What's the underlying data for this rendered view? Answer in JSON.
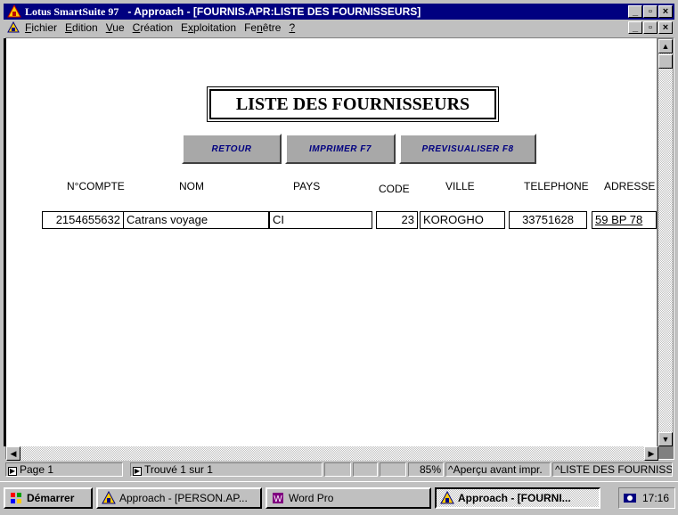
{
  "window": {
    "app_name": "Lotus SmartSuite 97",
    "title": "-  Approach - [FOURNIS.APR:LISTE DES FOURNISSEURS]",
    "controls": [
      "_",
      "🗗",
      "✕"
    ]
  },
  "menu": {
    "items": [
      {
        "label": "Fichier",
        "key": "F",
        "rest": "ichier"
      },
      {
        "label": "Edition",
        "key": "E",
        "rest": "dition"
      },
      {
        "label": "Vue",
        "key": "V",
        "rest": "ue"
      },
      {
        "label": "Création",
        "key": "C",
        "rest": "réation"
      },
      {
        "label": "Exploitation",
        "pre": "E",
        "key": "x",
        "rest": "ploitation"
      },
      {
        "label": "Fenêtre",
        "pre": "Fe",
        "key": "n",
        "rest": "être"
      },
      {
        "label": "?",
        "key": "?",
        "rest": ""
      }
    ]
  },
  "form": {
    "title": "LISTE DES FOURNISSEURS",
    "buttons": {
      "retour": "RETOUR",
      "imprimer": "IMPRIMER F7",
      "previsualiser": "PREVISUALISER F8"
    },
    "columns": {
      "compte": "N°COMPTE",
      "nom": "NOM",
      "pays": "PAYS",
      "code": "CODE",
      "ville": "VILLE",
      "telephone": "TELEPHONE",
      "adresse": "ADRESSE"
    },
    "record": {
      "compte": "2154655632",
      "nom": "Catrans voyage",
      "pays": "CI",
      "code": "23",
      "ville": "KOROGHO",
      "telephone": "33751628",
      "adresse": "59 BP 78"
    }
  },
  "status": {
    "page": "Page 1",
    "found": "Trouvé 1 sur 1",
    "zoom": "85%",
    "mode": "^Aperçu avant impr.",
    "view": "^LISTE DES FOURNISSEUR"
  },
  "taskbar": {
    "start": "Démarrer",
    "tasks": [
      "Approach - [PERSON.AP...",
      "Word Pro",
      "Approach - [FOURNI..."
    ],
    "clock": "17:16"
  },
  "colors": {
    "titlebar": "#000080",
    "button_face": "#a8a8a8",
    "button_text": "#000080",
    "chrome": "#c0c0c0"
  }
}
